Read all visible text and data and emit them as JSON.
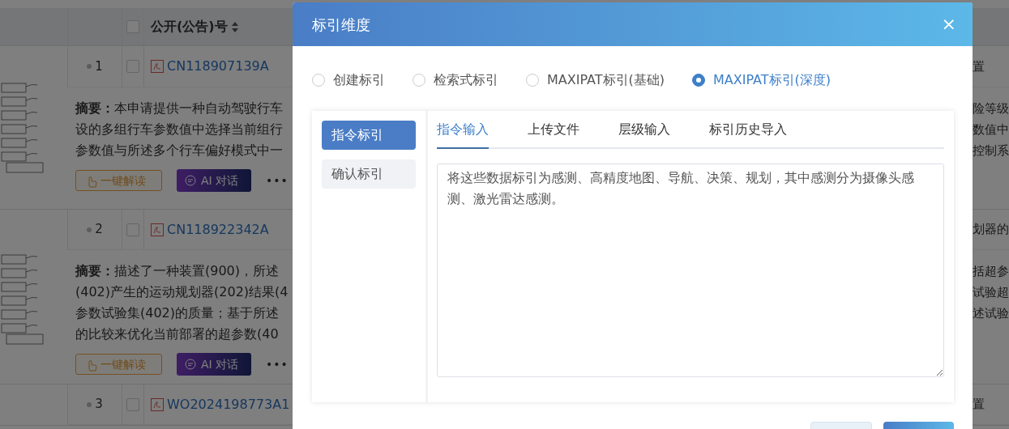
{
  "table": {
    "header": {
      "checkbox_checked": false,
      "column_label": "公开(公告)号"
    },
    "rows": [
      {
        "index": "1",
        "checked": false,
        "number": "CN118907139A",
        "right_text": "置",
        "abstract_lines": [
          "**摘要：**本申请提供一种自动驾驶行车",
          "设的多组行车参数值中选择当前组行",
          "参数值与所述多个行车偏好模式中一"
        ],
        "abstract_right": [
          "险等级",
          "数值中",
          "控制系"
        ],
        "buttons": [
          "一键解读",
          "AI 对话"
        ],
        "more": "•••"
      },
      {
        "index": "2",
        "checked": false,
        "number": "CN118922342A",
        "right_text": "划器的",
        "abstract_lines": [
          "**摘要：**描述了一种装置(900)，所述",
          "(402)产生的运动规划器(202)结果(4",
          "参数试验集(402)的质量；基于所述",
          "的比较来优化当前部署的超参数(40"
        ],
        "abstract_right": [
          "括超参",
          "试验超",
          "述试验"
        ],
        "buttons": [
          "一键解读",
          "AI 对话"
        ],
        "more": "•••"
      },
      {
        "index": "3",
        "checked": false,
        "number": "WO2024198773A1",
        "right_text": "置"
      }
    ]
  },
  "modal": {
    "title": "标引维度",
    "close": "×",
    "modes": [
      {
        "label": "创建标引",
        "selected": false
      },
      {
        "label": "检索式标引",
        "selected": false
      },
      {
        "label": "MAXIPAT标引(基础)",
        "selected": false
      },
      {
        "label": "MAXIPAT标引(深度)",
        "selected": true
      }
    ],
    "steps": [
      {
        "label": "指令标引",
        "selected": true
      },
      {
        "label": "确认标引",
        "selected": false
      }
    ],
    "tabs": [
      {
        "label": "指令输入",
        "selected": true
      },
      {
        "label": "上传文件",
        "selected": false
      },
      {
        "label": "层级输入",
        "selected": false
      },
      {
        "label": "标引历史导入",
        "selected": false
      }
    ],
    "instruction": {
      "value": "将这些数据标引为感测、高精度地图、导航、决策、规划，其中感测分为摄像头感测、激光雷达感测。"
    },
    "footer_buttons": [
      {
        "kind": "secondary"
      },
      {
        "kind": "primary"
      }
    ]
  }
}
